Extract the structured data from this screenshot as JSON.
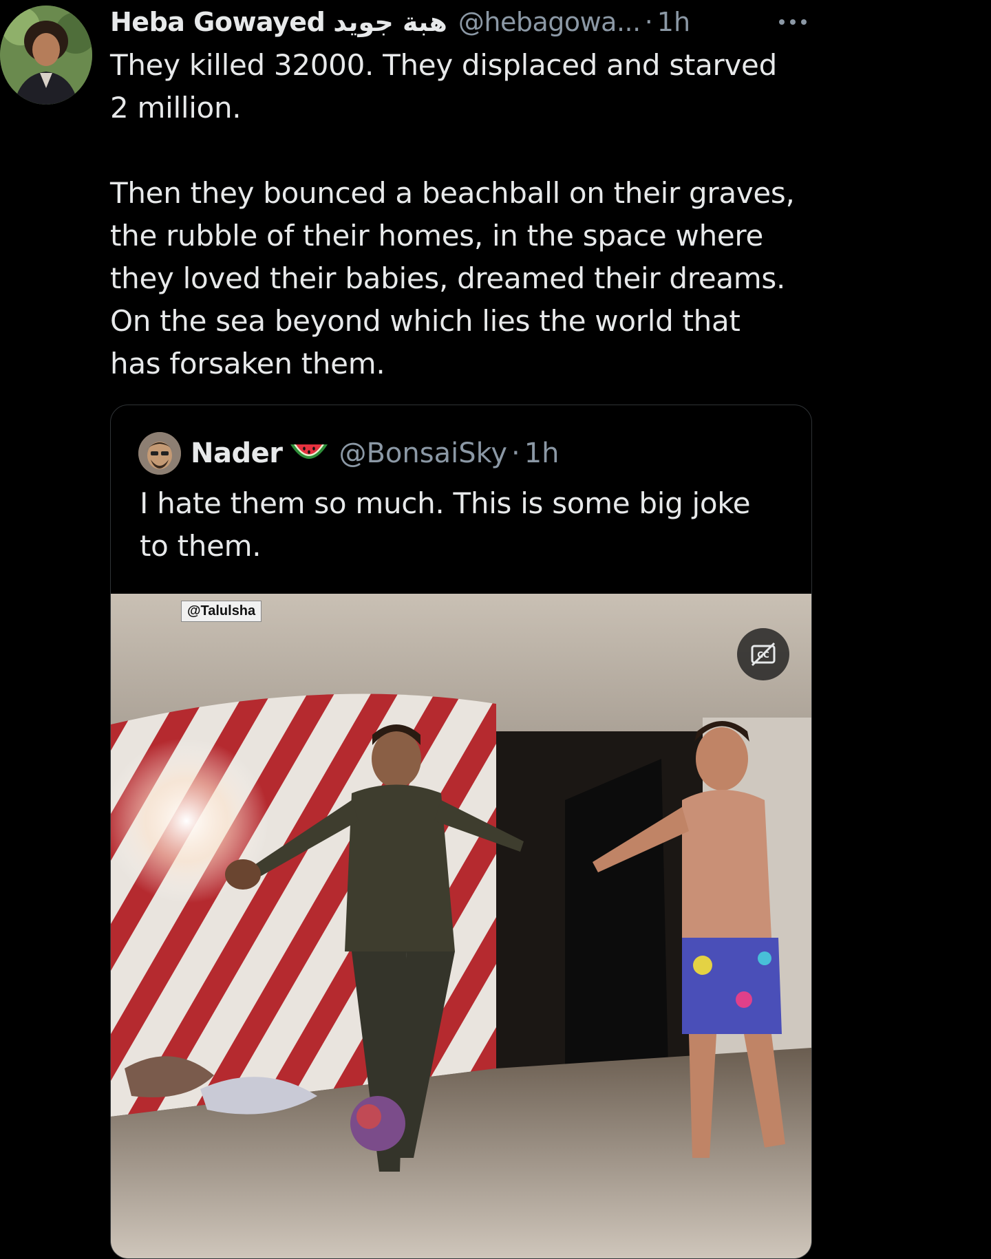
{
  "tweet": {
    "author_name": "Heba Gowayed",
    "author_name_arabic": "هبة جويد",
    "handle": "@hebagowa...",
    "separator": "·",
    "time": "1h",
    "paragraphs": [
      "They killed 32000. They displaced and starved\n2 million.",
      "Then they bounced a beachball on their graves,\nthe rubble of their homes, in the space where\nthey loved their babies, dreamed their dreams.\nOn the sea beyond which lies the world that\nhas forsaken them."
    ],
    "icons": {
      "avatar": "profile-photo",
      "more": "more-horizontal-icon"
    }
  },
  "quoted_tweet": {
    "author_name": "Nader",
    "emoji_icon": "watermelon-icon",
    "handle": "@BonsaiSky",
    "separator": "·",
    "time": "1h",
    "text": "I hate them so much. This is some big joke\nto them.",
    "video": {
      "watermark": "@Talulsha",
      "captions_icon": "captions-off-icon"
    }
  },
  "colors": {
    "background": "#000000",
    "primary_text": "#e7e9ea",
    "secondary_text": "#8b98a5",
    "border": "#2f3336"
  }
}
